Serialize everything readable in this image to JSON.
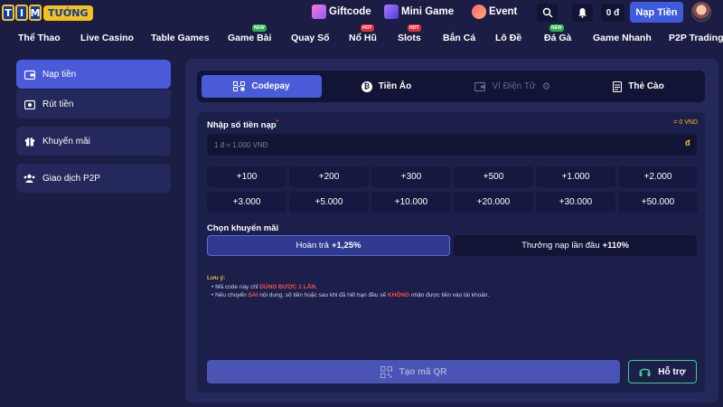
{
  "header": {
    "logo": {
      "letters": [
        "T",
        "I",
        "M"
      ],
      "word": "TƯỚNG"
    },
    "promos": [
      {
        "label": "Giftcode",
        "color": "#d96bff"
      },
      {
        "label": "Mini Game",
        "color": "#7a64ff"
      },
      {
        "label": "Event",
        "color": "#ff7a9a"
      }
    ],
    "balance": "0 đ",
    "deposit_label": "Nạp Tiền"
  },
  "nav": [
    {
      "label": "Thể Thao",
      "badge": ""
    },
    {
      "label": "Live Casino",
      "badge": ""
    },
    {
      "label": "Table Games",
      "badge": ""
    },
    {
      "label": "Game Bài",
      "badge": "NEW"
    },
    {
      "label": "Quay Số",
      "badge": ""
    },
    {
      "label": "Nổ Hũ",
      "badge": "HOT"
    },
    {
      "label": "Slots",
      "badge": "HOT"
    },
    {
      "label": "Bắn Cá",
      "badge": ""
    },
    {
      "label": "Lô Đề",
      "badge": ""
    },
    {
      "label": "Đá Gà",
      "badge": "NEW"
    },
    {
      "label": "Game Nhanh",
      "badge": ""
    },
    {
      "label": "P2P Trading",
      "badge": ""
    }
  ],
  "sidebar": [
    {
      "label": "Nạp tiền",
      "icon": "wallet-icon",
      "active": true
    },
    {
      "label": "Rút tiền",
      "icon": "withdraw-icon",
      "active": false
    },
    {
      "label": "Khuyến mãi",
      "icon": "gift-icon",
      "active": false
    },
    {
      "label": "Giao dịch P2P",
      "icon": "users-icon",
      "active": false
    }
  ],
  "tabs": [
    {
      "label": "Codepay",
      "icon": "codepay-icon",
      "state": "active"
    },
    {
      "label": "Tiền Ảo",
      "icon": "bitcoin-icon",
      "state": "normal"
    },
    {
      "label": "Ví Điện Tử",
      "icon": "ewallet-icon",
      "state": "disabled"
    },
    {
      "label": "Thẻ Cào",
      "icon": "card-icon",
      "state": "normal"
    }
  ],
  "form": {
    "amount_label": "Nhập số tiền nạp",
    "required_mark": "*",
    "rate": "= 0 VND",
    "placeholder": "1 đ = 1.000 VNĐ",
    "currency": "đ",
    "quick_amounts": [
      "+100",
      "+200",
      "+300",
      "+500",
      "+1.000",
      "+2.000",
      "+3.000",
      "+5.000",
      "+10.000",
      "+20.000",
      "+30.000",
      "+50.000"
    ],
    "promo_label": "Chọn khuyến mãi",
    "promos": [
      {
        "text": "Hoàn trả",
        "value": "+1,25%"
      },
      {
        "text": "Thưởng nạp lần đầu",
        "value": "+110%"
      }
    ],
    "note": {
      "title": "Lưu ý:",
      "line1_a": "Mã code này chỉ ",
      "line1_b": "DÙNG ĐƯỢC 1 LẦN",
      "line1_c": ".",
      "line2_a": "Nếu chuyển ",
      "line2_b": "SAI",
      "line2_c": " nội dung, số tiền hoặc sau khi đã hết hạn đều sẽ ",
      "line2_d": "KHÔNG",
      "line2_e": " nhận được tiền vào tài khoản."
    },
    "qr_button": "Tạo mã QR",
    "help_button": "Hỗ trợ"
  },
  "colors": {
    "accent": "#4a5ad8",
    "gold": "#f6c21a",
    "help": "#3fd08a"
  }
}
